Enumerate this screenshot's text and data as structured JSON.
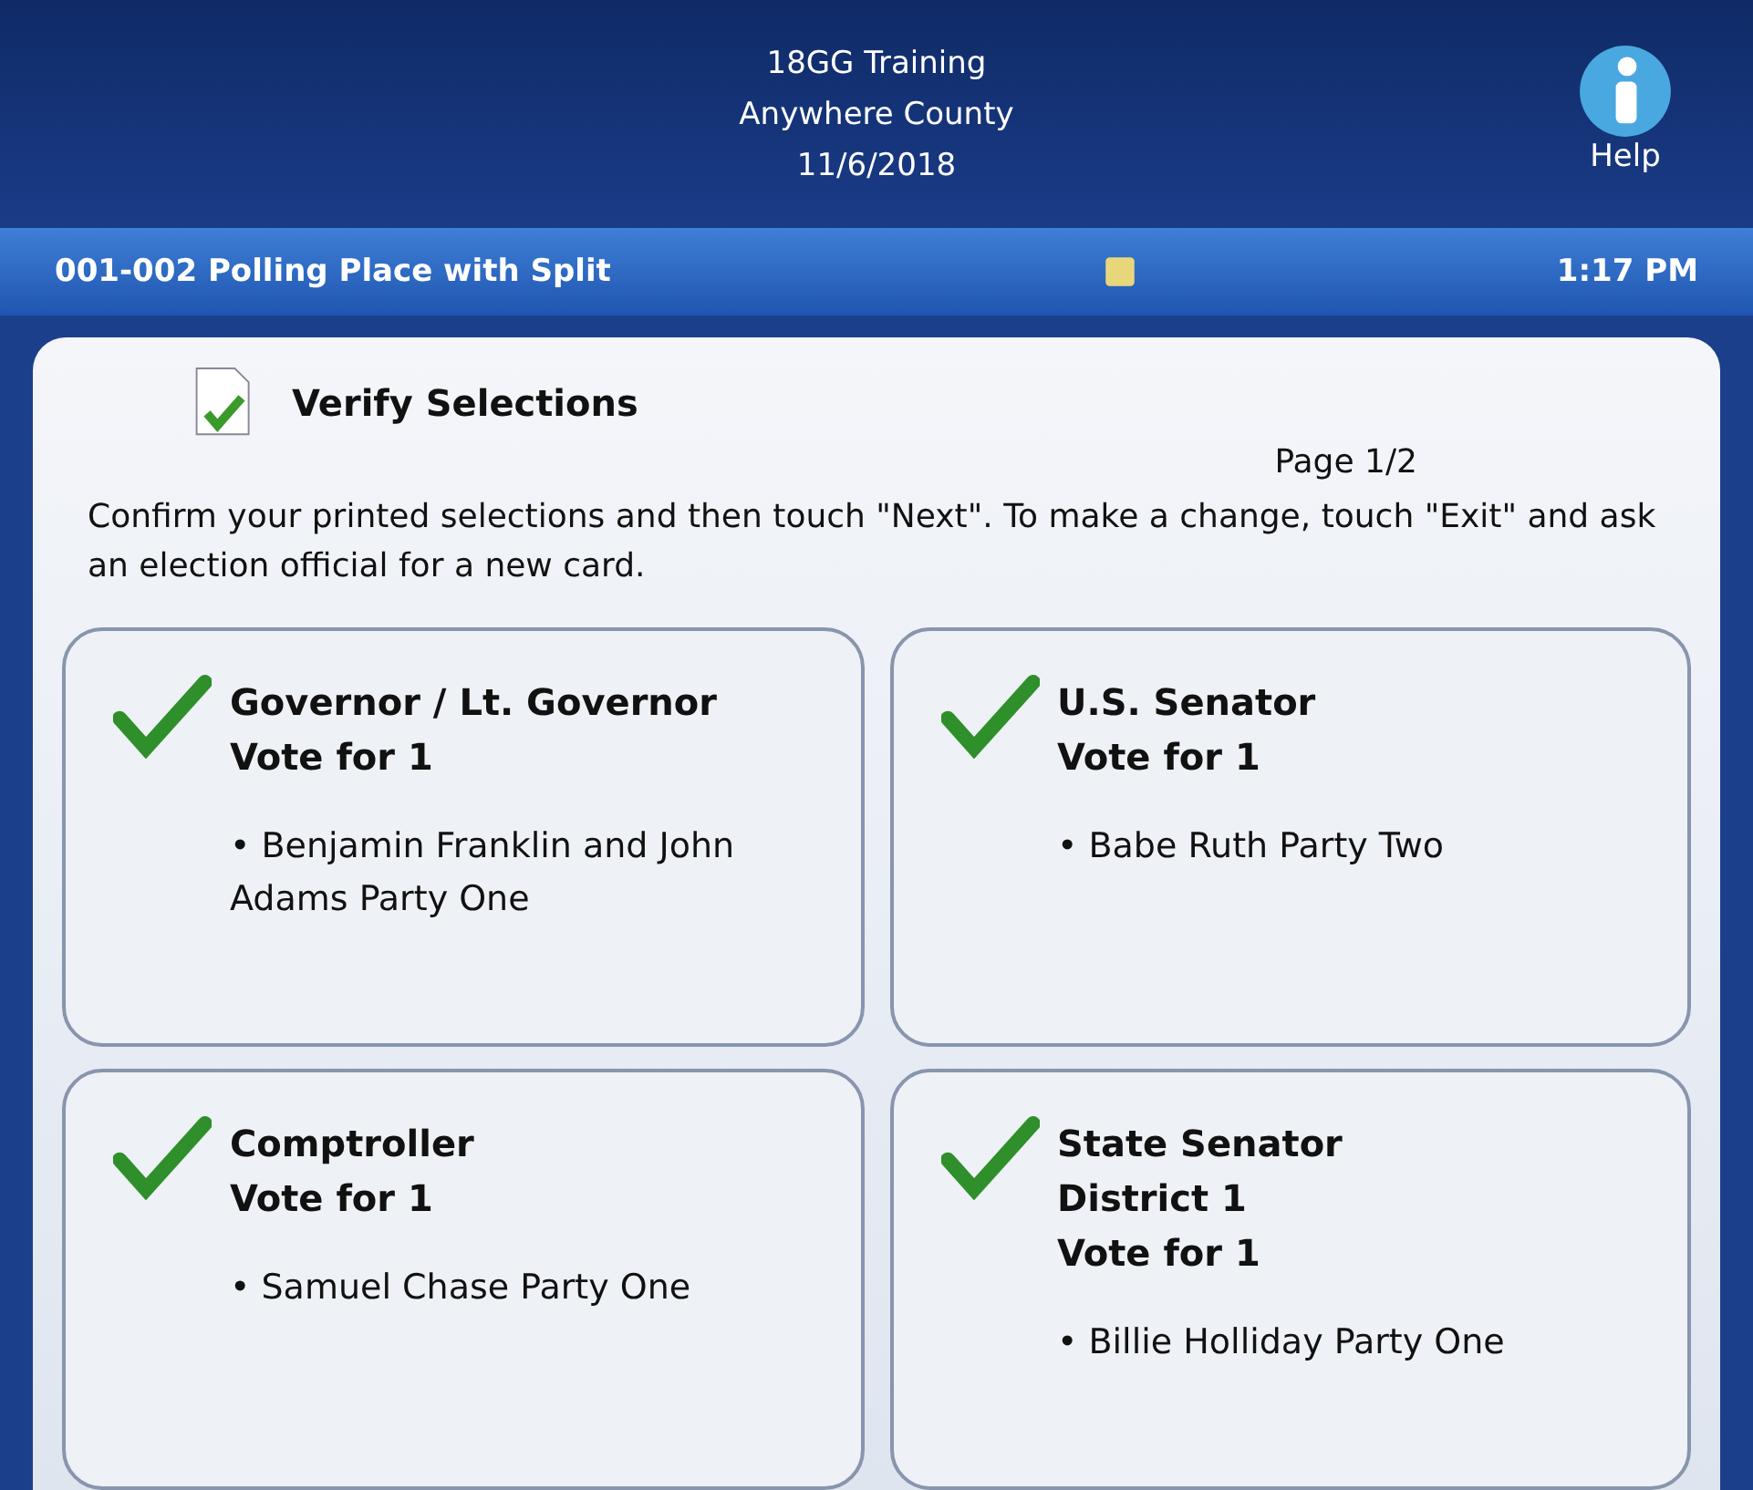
{
  "header": {
    "lines": [
      "18GG Training",
      "Anywhere County",
      "11/6/2018"
    ],
    "help_label": "Help"
  },
  "status_bar": {
    "location": "001-002 Polling Place with Split",
    "time": "1:17 PM"
  },
  "panel": {
    "title": "Verify Selections",
    "page": "Page 1/2",
    "instructions": "Confirm your printed selections and then touch \"Next\".  To make a change, touch \"Exit\" and ask an election official for a new card."
  },
  "contests": [
    {
      "title_lines": [
        "Governor / Lt. Governor",
        "Vote for 1"
      ],
      "selections": [
        "• Benjamin Franklin and John Adams Party One"
      ]
    },
    {
      "title_lines": [
        "U.S. Senator",
        "Vote for 1"
      ],
      "selections": [
        "• Babe Ruth Party Two"
      ]
    },
    {
      "title_lines": [
        "Comptroller",
        "Vote for 1"
      ],
      "selections": [
        "• Samuel Chase Party One"
      ]
    },
    {
      "title_lines": [
        "State Senator",
        "District 1",
        "Vote for 1"
      ],
      "selections": [
        "• Billie Holliday Party One"
      ]
    }
  ]
}
